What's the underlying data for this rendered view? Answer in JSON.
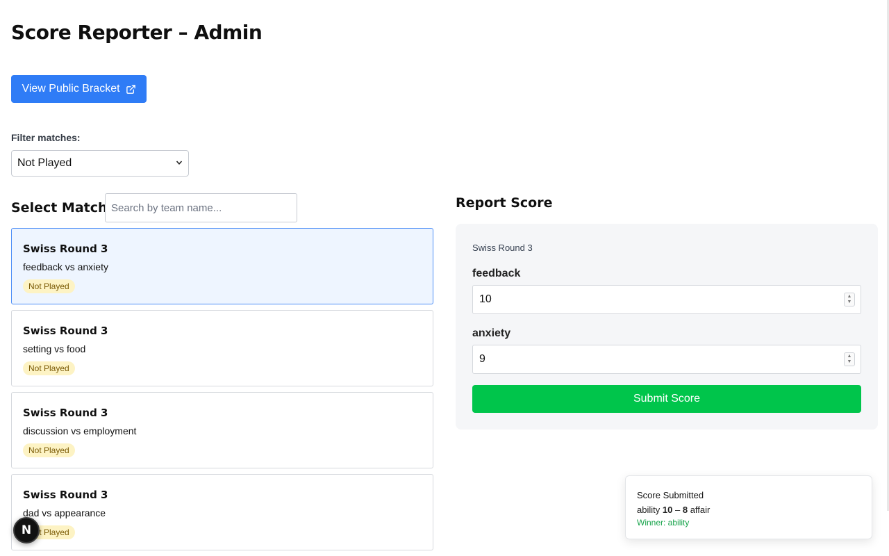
{
  "page": {
    "title": "Score Reporter – Admin"
  },
  "toolbar": {
    "public_bracket_label": "View Public Bracket",
    "public_bracket_icon": "external-link-icon"
  },
  "filter": {
    "label": "Filter matches:",
    "selected": "Not Played"
  },
  "select_match": {
    "heading": "Select Match",
    "search_placeholder": "Search by team name..."
  },
  "matches": [
    {
      "round": "Swiss Round 3",
      "teams": "feedback vs anxiety",
      "status": "Not Played",
      "selected": true
    },
    {
      "round": "Swiss Round 3",
      "teams": "setting vs food",
      "status": "Not Played",
      "selected": false
    },
    {
      "round": "Swiss Round 3",
      "teams": "discussion vs employment",
      "status": "Not Played",
      "selected": false
    },
    {
      "round": "Swiss Round 3",
      "teams": "dad vs appearance",
      "status": "Not Played",
      "selected": false
    }
  ],
  "report": {
    "heading": "Report Score",
    "round": "Swiss Round 3",
    "team1_label": "feedback",
    "team1_score": "10",
    "team2_label": "anxiety",
    "team2_score": "9",
    "submit_label": "Submit Score"
  },
  "toast": {
    "title": "Score Submitted",
    "team1": "ability",
    "score1": "10",
    "dash": "–",
    "score2": "8",
    "team2": "affair",
    "winner": "Winner: ability"
  },
  "dev_badge": {
    "letter": "N",
    "icon": "nextjs-logo-icon"
  },
  "colors": {
    "primary_button": "#2f7cf6",
    "submit_button": "#00c54b",
    "selected_card_bg": "#eef5ff",
    "status_badge_bg": "#fdf3c4",
    "winner_text": "#16a34a"
  }
}
